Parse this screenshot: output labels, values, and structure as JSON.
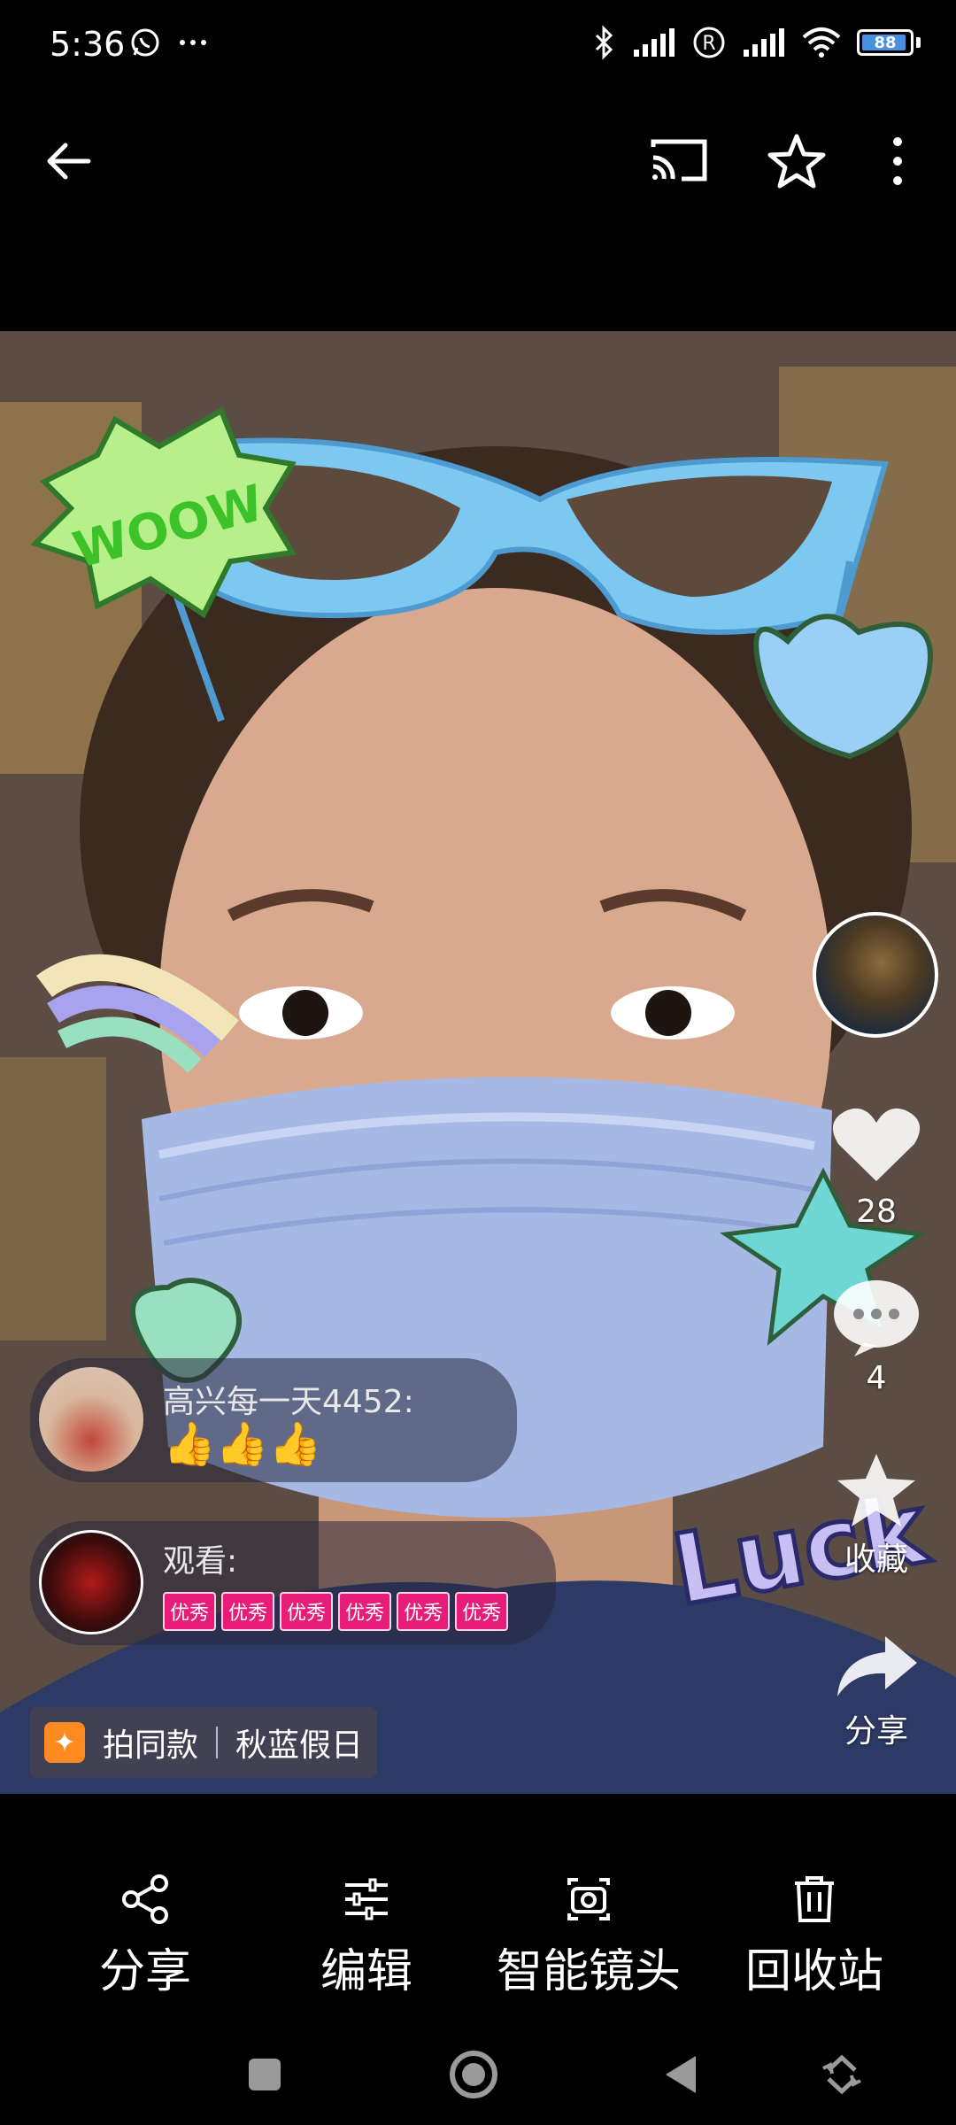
{
  "status_bar": {
    "time": "5:36",
    "battery": "88"
  },
  "top_bar": {
    "back_icon": "arrow-left-icon",
    "cast_icon": "cast-icon",
    "favorite_icon": "star-outline-icon",
    "more_icon": "more-vertical-icon"
  },
  "photo": {
    "likes_count": "28",
    "comments_count": "4",
    "collect_label": "收藏",
    "share_label": "分享",
    "comment1": {
      "user": "高兴每一天4452:",
      "text": "👍👍👍"
    },
    "comment2": {
      "user": "观看:",
      "badges": [
        "优秀",
        "优秀",
        "优秀",
        "优秀",
        "优秀",
        "优秀"
      ]
    },
    "same_style_label": "拍同款",
    "music_label": "秋蓝假日",
    "sticker_text_wow": "WOOW",
    "sticker_text_luck": "Luck"
  },
  "bottom_toolbar": {
    "share": "分享",
    "edit": "编辑",
    "smart_lens": "智能镜头",
    "recycle_bin": "回收站"
  },
  "colors": {
    "background": "#000000",
    "badge": "#e81d79",
    "glasses": "#7cc8f0"
  }
}
